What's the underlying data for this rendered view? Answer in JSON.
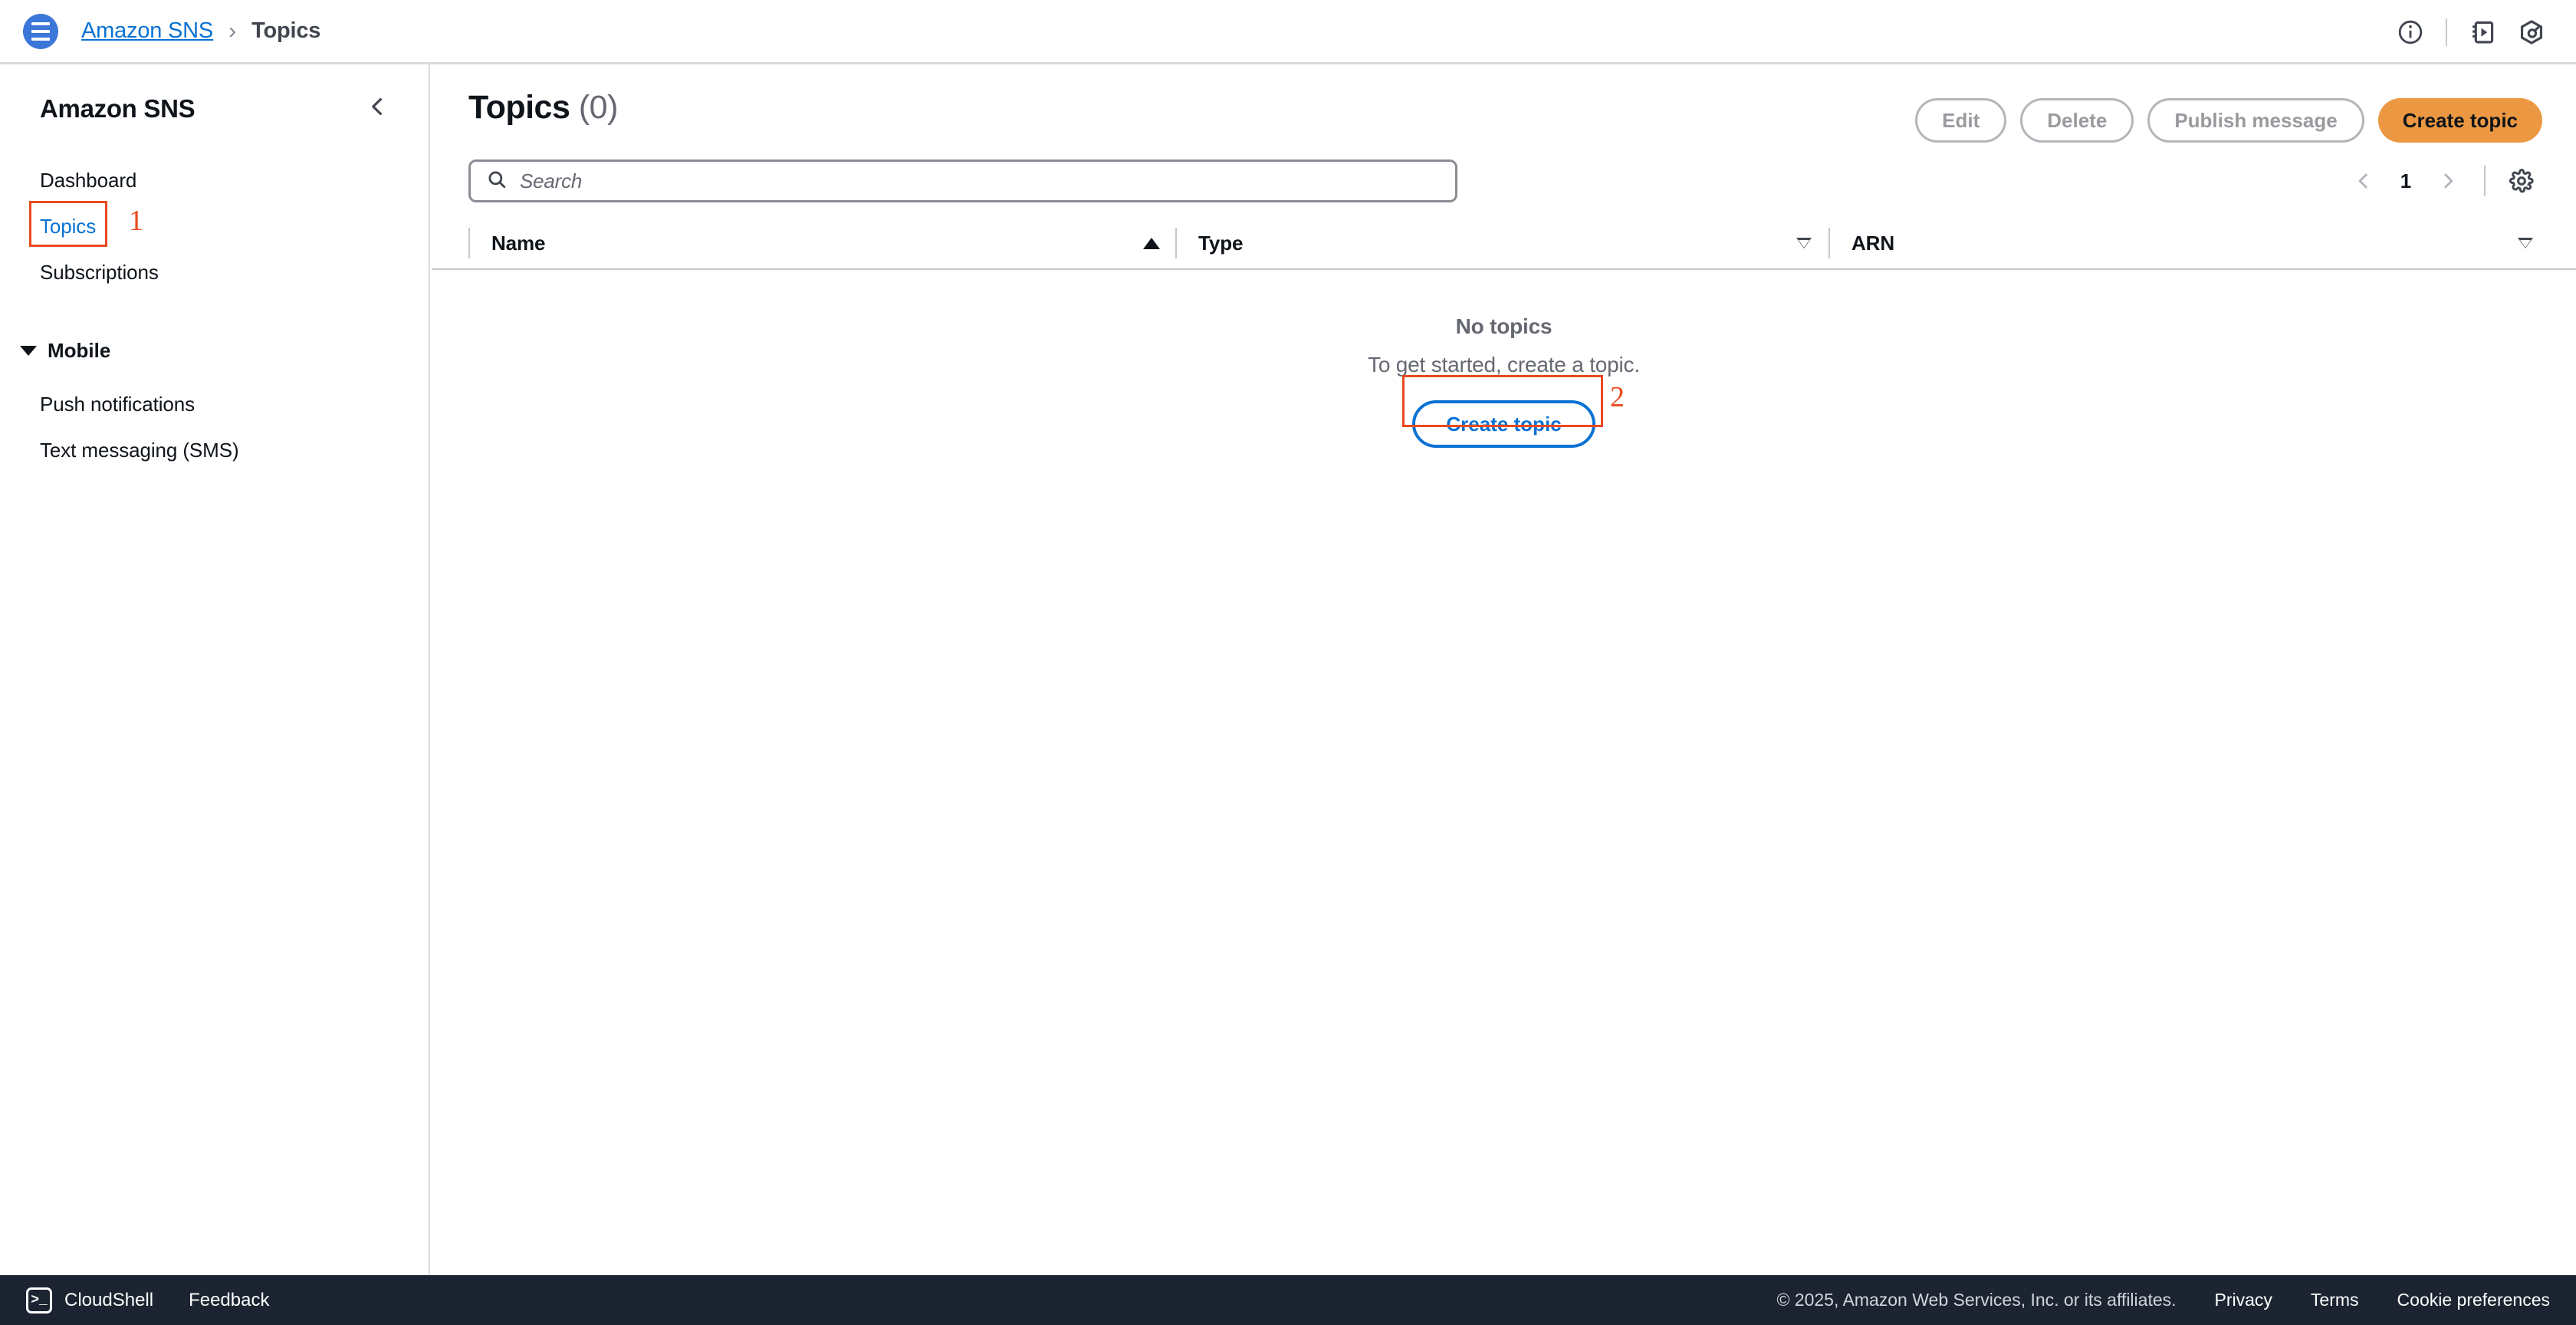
{
  "topbar": {
    "menu_icon": "hamburger-menu-icon",
    "breadcrumb": {
      "root": "Amazon SNS",
      "separator": "›",
      "current": "Topics"
    },
    "icons": [
      {
        "name": "info-circle-icon",
        "glyph": "info"
      },
      {
        "name": "notebook-tutorial-icon",
        "glyph": "notebook"
      },
      {
        "name": "settings-hexagon-icon",
        "glyph": "hexagon"
      }
    ]
  },
  "sidebar": {
    "title": "Amazon SNS",
    "collapse_icon": "chevron-left-icon",
    "items": [
      {
        "label": "Dashboard",
        "selected": false
      },
      {
        "label": "Topics",
        "selected": true
      },
      {
        "label": "Subscriptions",
        "selected": false
      }
    ],
    "section": {
      "label": "Mobile",
      "expanded": true,
      "items": [
        {
          "label": "Push notifications"
        },
        {
          "label": "Text messaging (SMS)"
        }
      ]
    }
  },
  "main": {
    "title": "Topics",
    "count": "(0)",
    "actions": [
      {
        "label": "Edit",
        "disabled": true,
        "variant": "outline"
      },
      {
        "label": "Delete",
        "disabled": true,
        "variant": "outline"
      },
      {
        "label": "Publish message",
        "disabled": true,
        "variant": "outline"
      },
      {
        "label": "Create topic",
        "disabled": false,
        "variant": "primary"
      }
    ],
    "search": {
      "placeholder": "Search",
      "value": "",
      "icon": "search-icon"
    },
    "pagination": {
      "prev_icon": "chevron-left-icon",
      "next_icon": "chevron-right-icon",
      "page": "1",
      "prev_disabled": true,
      "next_disabled": true
    },
    "preferences_icon": "gear-icon",
    "table": {
      "columns": [
        {
          "label": "Name",
          "sort": "asc"
        },
        {
          "label": "Type",
          "sort": "none"
        },
        {
          "label": "ARN",
          "sort": "none"
        }
      ],
      "rows": []
    },
    "empty_state": {
      "title": "No topics",
      "subtitle": "To get started, create a topic.",
      "button_label": "Create topic"
    }
  },
  "annotations": [
    {
      "number": "1",
      "target": "sidebar-item-topics",
      "color": "#ea4a1f"
    },
    {
      "number": "2",
      "target": "empty-state-create-topic-button",
      "color": "#ea4a1f"
    }
  ],
  "footer": {
    "cloudshell": {
      "label": "CloudShell",
      "icon": "cloudshell-terminal-icon",
      "glyph": ">_"
    },
    "feedback": "Feedback",
    "copyright": "© 2025, Amazon Web Services, Inc. or its affiliates.",
    "links": [
      "Privacy",
      "Terms",
      "Cookie preferences"
    ]
  },
  "colors": {
    "accent_blue": "#0972d3",
    "brand_orange": "#ec9842",
    "annotation_red": "#ea4a1f",
    "footer_bg": "#1b2430",
    "logo_blue": "#3b76d9"
  }
}
